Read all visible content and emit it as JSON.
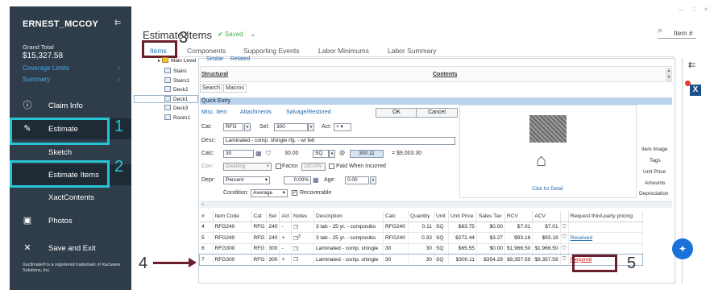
{
  "sidebar": {
    "user": "ERNEST_MCCOY",
    "grand_total_label": "Grand Total",
    "grand_total_value": "$15,327.58",
    "coverage_limits": "Coverage Limits",
    "summary": "Summary",
    "nav": [
      {
        "label": "Claim Info",
        "icon": "info-icon"
      },
      {
        "label": "Estimate",
        "icon": "hammer-icon"
      },
      {
        "label": "Sketch"
      },
      {
        "label": "Estimate Items"
      },
      {
        "label": "XactContents"
      },
      {
        "label": "Photos",
        "icon": "photo-icon"
      },
      {
        "label": "Save and Exit",
        "icon": "close-icon"
      }
    ],
    "trademark": "Xactimate® is a registered trademark of Xactware Solutions, Inc."
  },
  "header": {
    "title": "Estimate Items",
    "saved": "Saved",
    "search_placeholder": "Item #",
    "tabs": [
      "Items",
      "Components",
      "Supporting Events",
      "Labor Minimums",
      "Labor Summary"
    ]
  },
  "tree": {
    "top_label": "Main Level",
    "items": [
      "Stairs",
      "Stairs1",
      "Deck2",
      "Deck1",
      "Deck3",
      "Room1"
    ]
  },
  "panel": {
    "similar": "Similar",
    "related": "Related",
    "structural": "Structural",
    "contents": "Contents",
    "search": "Search",
    "macros": "Macros",
    "quick_entry": "Quick Entry",
    "misc_item": "Misc. Item",
    "attachments": "Attachments",
    "salvage": "Salvage/Restored",
    "ok": "OK",
    "cancel": "Cancel",
    "cat_label": "Cat:",
    "cat_value": "RFG",
    "sel_label": "Sel:",
    "sel_value": "300",
    "act_label": "Act:",
    "act_value": "+",
    "desc_label": "Desc:",
    "desc_value": "Laminated - comp. shingle rfg. - w/ felt",
    "calc_label": "Calc:",
    "calc_value": "30",
    "qty_value": "30.00",
    "unit_value": "SQ",
    "at": "@",
    "price_value": "300.11",
    "total": "= $9,003.30",
    "cov_label": "Cov:",
    "cov_value": "Dwelling",
    "factor": "Factor",
    "factor_value": "100.0%",
    "paid_when": "Paid When Incurred",
    "depr_label": "Depr:",
    "depr_value": "Percent",
    "depr_pct": "0.00%",
    "age_label": "Age:",
    "age_value": "0.00",
    "condition_label": "Condition:",
    "condition_value": "Average",
    "recoverable": "Recoverable",
    "click_detail": "Click for Detail",
    "side_tabs": [
      "Item Image",
      "Tags",
      "Unit Price",
      "Amounts",
      "Depreciation"
    ]
  },
  "table": {
    "headers": [
      "#",
      "Item Code",
      "Cat",
      "Sel",
      "Act",
      "Notes",
      "Description",
      "Calc",
      "Quantity",
      "Unit",
      "Unit Price",
      "Sales Tax",
      "RCV",
      "ACV",
      "",
      "Request third-party pricing"
    ],
    "rows": [
      [
        "4",
        "RFG240",
        "RFG",
        "240",
        "-",
        "",
        "3 tab - 25 yr. - compositio",
        "RFG240",
        "0.11",
        "SQ",
        "$63.75",
        "$0.00",
        "$7.01",
        "$7.01",
        "",
        ""
      ],
      [
        "5",
        "RFG240",
        "RFG",
        "240",
        "+",
        "3",
        "3 tab - 25 yr. - compositio",
        "RFG240",
        "0.33",
        "SQ",
        "$272.44",
        "$3.27",
        "$93.18",
        "$93.18",
        "",
        "Received"
      ],
      [
        "6",
        "RFG300",
        "RFG",
        "300",
        "-",
        "",
        "Laminated - comp. shingle",
        "30",
        "30",
        "SQ",
        "$65.55",
        "$0.00",
        "$1,966.50",
        "$1,966.50",
        "",
        ""
      ],
      [
        "7",
        "RFG300",
        "RFG",
        "300",
        "+",
        "",
        "Laminated - comp. shingle",
        "30",
        "30",
        "SQ",
        "$300.11",
        "$354.29",
        "$9,357.59",
        "$9,357.59",
        "",
        "Required"
      ]
    ]
  },
  "annotations": [
    "1",
    "2",
    "3",
    "4",
    "5"
  ]
}
